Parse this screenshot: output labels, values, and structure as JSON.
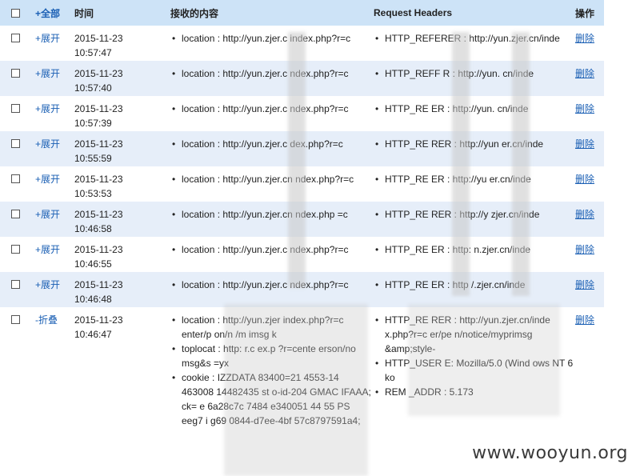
{
  "header": {
    "all_label": "+全部",
    "time": "时间",
    "content": "接收的内容",
    "headers": "Request Headers",
    "actions": "操作"
  },
  "rows": [
    {
      "toggle": "+展开",
      "date": "2015-11-23",
      "time": "10:57:47",
      "content": [
        "location : http://yun.zjer.c      index.php?r=c"
      ],
      "headers": [
        "HTTP_REFERER : http://yun.zjer.cn/inde"
      ],
      "delete": "删除"
    },
    {
      "toggle": "+展开",
      "date": "2015-11-23",
      "time": "10:57:40",
      "content": [
        "location : http://yun.zjer.c      ndex.php?r=c"
      ],
      "headers": [
        "HTTP_REFF      R : http://yun.       cn/inde"
      ],
      "delete": "删除"
    },
    {
      "toggle": "+展开",
      "date": "2015-11-23",
      "time": "10:57:39",
      "content": [
        "location : http://yun.zjer.c      ndex.php?r=c"
      ],
      "headers": [
        "HTTP_RE        ER : http://yun.      cn/inde"
      ],
      "delete": "删除"
    },
    {
      "toggle": "+展开",
      "date": "2015-11-23",
      "time": "10:55:59",
      "content": [
        "location : http://yun.zjer.c      dex.php?r=c"
      ],
      "headers": [
        "HTTP_RE        RER : http://yun      er.cn/inde"
      ],
      "delete": "删除"
    },
    {
      "toggle": "+展开",
      "date": "2015-11-23",
      "time": "10:53:53",
      "content": [
        "location : http://yun.zjer.cn      ndex.php?r=c"
      ],
      "headers": [
        "HTTP_RE        ER : http://yu      er.cn/inde"
      ],
      "delete": "删除"
    },
    {
      "toggle": "+展开",
      "date": "2015-11-23",
      "time": "10:46:58",
      "content": [
        "location : http://yun.zjer.cn      ndex.php   =c"
      ],
      "headers": [
        "HTTP_RE        RER : http://y      zjer.cn/inde"
      ],
      "delete": "删除"
    },
    {
      "toggle": "+展开",
      "date": "2015-11-23",
      "time": "10:46:55",
      "content": [
        "location : http://yun.zjer.c      ndex.php?r=c"
      ],
      "headers": [
        "HTTP_RE        ER : http:      n.zjer.cn/inde"
      ],
      "delete": "删除"
    },
    {
      "toggle": "+展开",
      "date": "2015-11-23",
      "time": "10:46:48",
      "content": [
        "location : http://yun.zjer.c      ndex.php?r=c"
      ],
      "headers": [
        "HTTP_RE        ER : http      /.zjer.cn/inde"
      ],
      "delete": "删除"
    },
    {
      "toggle": "-折叠",
      "date": "2015-11-23",
      "time": "10:46:47",
      "content": [
        "location : http://yun.zjer      index.php?r=c enter/p    on/n    /m   imsg    k",
        "toplocat   : http:      r.c   ex.p   ?r=cente   erson/no      msg&s      =yx",
        "cookie :     IZZDATA         83400=21   4553-14   463008       14482435   st o-id-204     GMAC      IFAAA; ck=    e 6a28c7c    7484      e340051    44 55     PS      eeg7      i g69    0844-d7ee-4bf    57c8797591a4;"
      ],
      "headers": [
        "HTTP_RE        RER : http://yun.zjer.cn/inde x.php?r=c    er/pe    n/notice/myprimsg &amp;style-",
        "HTTP_USER      E:   Mozilla/5.0 (Wind ows NT 6          ko",
        "REM     _ADDR :           5.173"
      ],
      "delete": "删除"
    }
  ],
  "watermark": "www.wooyun.org"
}
